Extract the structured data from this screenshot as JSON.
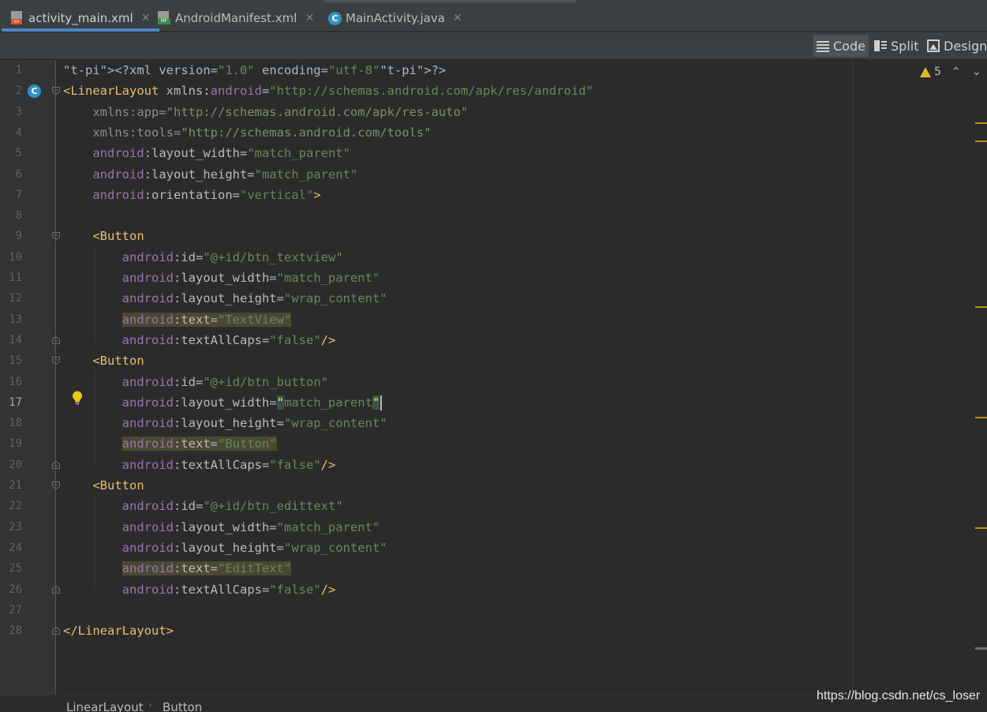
{
  "tabs": [
    {
      "label": "activity_main.xml",
      "icon": "xml-file-icon",
      "active": true
    },
    {
      "label": "AndroidManifest.xml",
      "icon": "manifest-file-icon",
      "active": false
    },
    {
      "label": "MainActivity.java",
      "icon": "java-class-icon",
      "active": false
    }
  ],
  "view_modes": {
    "code": "Code",
    "split": "Split",
    "design": "Design",
    "selected": "Code"
  },
  "inspections": {
    "warnings": "5"
  },
  "gutter_icons": {
    "class_marker": "C"
  },
  "current_line": 17,
  "line_numbers": [
    "1",
    "2",
    "3",
    "4",
    "5",
    "6",
    "7",
    "8",
    "9",
    "10",
    "11",
    "12",
    "13",
    "14",
    "15",
    "16",
    "17",
    "18",
    "19",
    "20",
    "21",
    "22",
    "23",
    "24",
    "25",
    "26",
    "27",
    "28"
  ],
  "code_lines": [
    "<?xml version=\"1.0\" encoding=\"utf-8\"?>",
    "<LinearLayout xmlns:android=\"http://schemas.android.com/apk/res/android\"",
    "    xmlns:app=\"http://schemas.android.com/apk/res-auto\"",
    "    xmlns:tools=\"http://schemas.android.com/tools\"",
    "    android:layout_width=\"match_parent\"",
    "    android:layout_height=\"match_parent\"",
    "    android:orientation=\"vertical\">",
    "",
    "    <Button",
    "        android:id=\"@+id/btn_textview\"",
    "        android:layout_width=\"match_parent\"",
    "        android:layout_height=\"wrap_content\"",
    "        android:text=\"TextView\"",
    "        android:textAllCaps=\"false\"/>",
    "    <Button",
    "        android:id=\"@+id/btn_button\"",
    "        android:layout_width=\"match_parent\"",
    "        android:layout_height=\"wrap_content\"",
    "        android:text=\"Button\"",
    "        android:textAllCaps=\"false\"/>",
    "    <Button",
    "        android:id=\"@+id/btn_edittext\"",
    "        android:layout_width=\"match_parent\"",
    "        android:layout_height=\"wrap_content\"",
    "        android:text=\"EditText\"",
    "        android:textAllCaps=\"false\"/>",
    "",
    "</LinearLayout>"
  ],
  "breadcrumb": [
    "LinearLayout",
    "Button"
  ],
  "watermark": "https://blog.csdn.net/cs_loser",
  "colors": {
    "tag": "#e8bf6a",
    "namespace": "#9876aa",
    "value": "#6a8759",
    "accent": "#4a88c7",
    "warning": "#e0b43a"
  }
}
